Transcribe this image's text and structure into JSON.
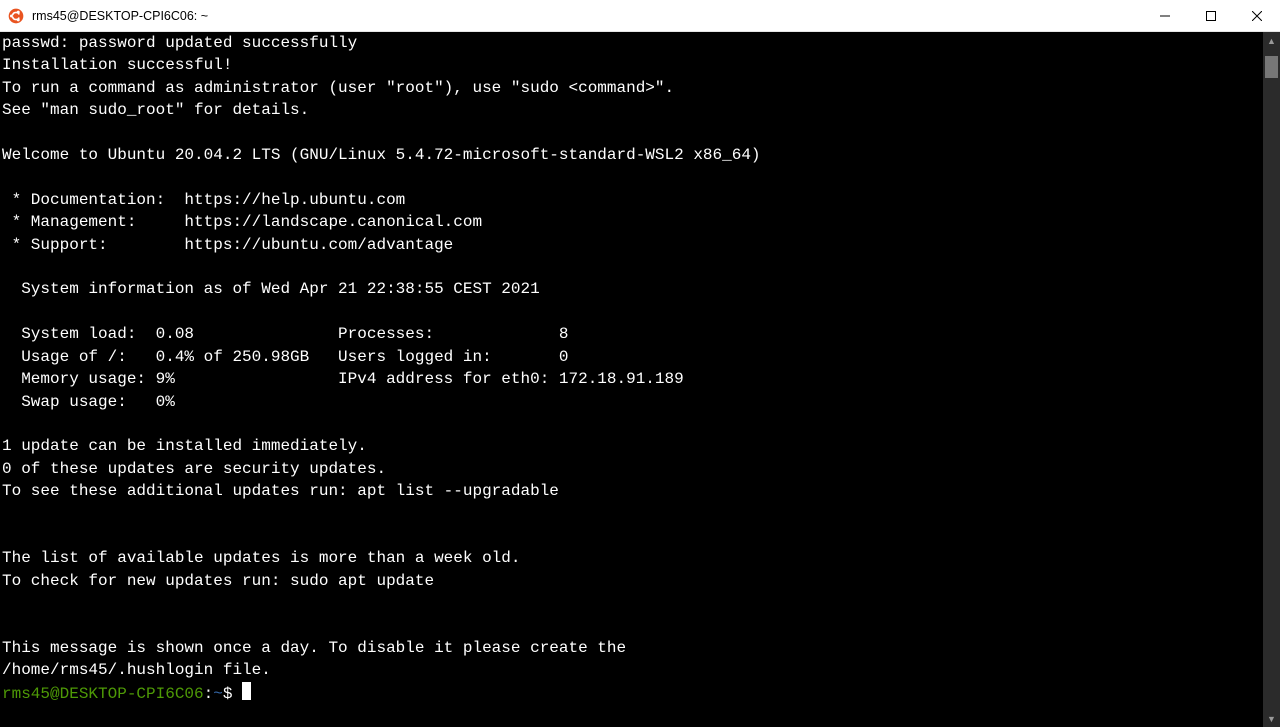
{
  "window": {
    "title": "rms45@DESKTOP-CPI6C06: ~",
    "icon": "ubuntu-icon"
  },
  "terminal": {
    "output": [
      "passwd: password updated successfully",
      "Installation successful!",
      "To run a command as administrator (user \"root\"), use \"sudo <command>\".",
      "See \"man sudo_root\" for details.",
      "",
      "Welcome to Ubuntu 20.04.2 LTS (GNU/Linux 5.4.72-microsoft-standard-WSL2 x86_64)",
      "",
      " * Documentation:  https://help.ubuntu.com",
      " * Management:     https://landscape.canonical.com",
      " * Support:        https://ubuntu.com/advantage",
      "",
      "  System information as of Wed Apr 21 22:38:55 CEST 2021",
      "",
      "  System load:  0.08               Processes:             8",
      "  Usage of /:   0.4% of 250.98GB   Users logged in:       0",
      "  Memory usage: 9%                 IPv4 address for eth0: 172.18.91.189",
      "  Swap usage:   0%",
      "",
      "1 update can be installed immediately.",
      "0 of these updates are security updates.",
      "To see these additional updates run: apt list --upgradable",
      "",
      "",
      "The list of available updates is more than a week old.",
      "To check for new updates run: sudo apt update",
      "",
      "",
      "This message is shown once a day. To disable it please create the",
      "/home/rms45/.hushlogin file."
    ],
    "prompt": {
      "user_host": "rms45@DESKTOP-CPI6C06",
      "separator": ":",
      "path": "~",
      "symbol": "$"
    }
  },
  "colors": {
    "terminal_bg": "#000000",
    "terminal_fg": "#ffffff",
    "prompt_user": "#4e9a06",
    "prompt_path": "#3465a4",
    "ubuntu_orange": "#e95420"
  }
}
